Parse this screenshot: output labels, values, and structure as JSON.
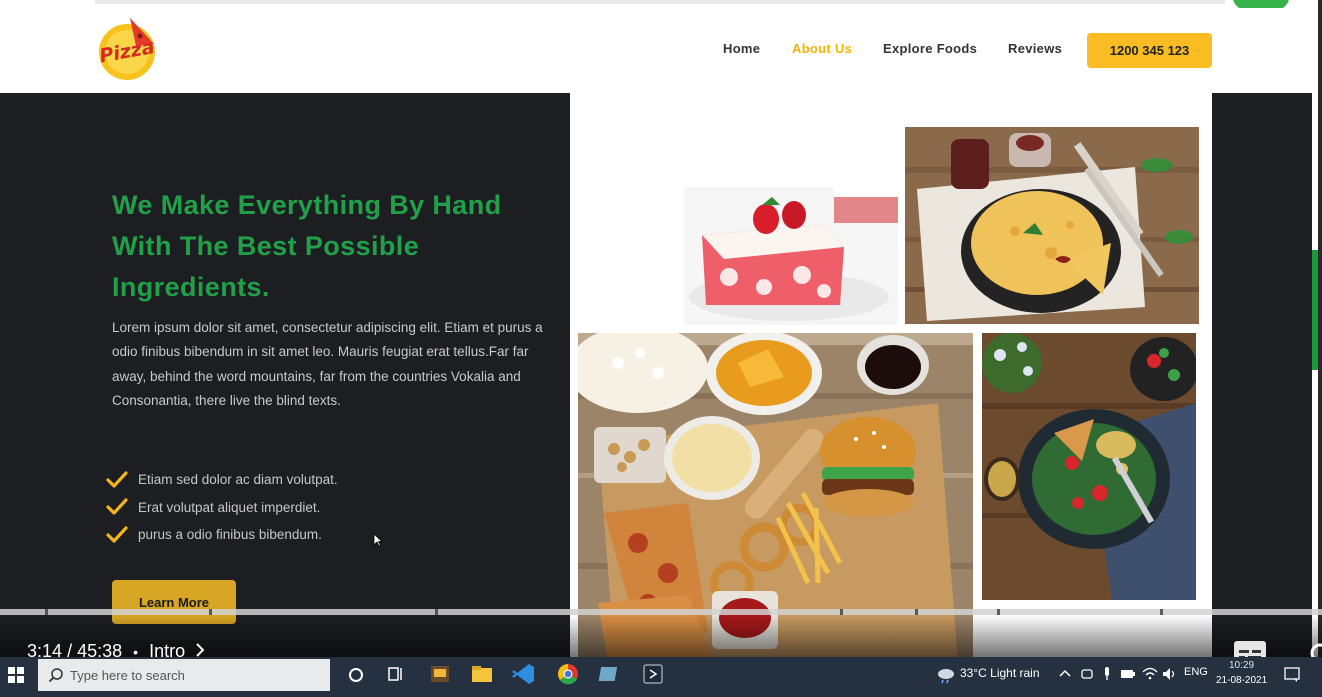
{
  "site": {
    "logo_text": "Pizza",
    "nav": {
      "items": [
        {
          "label": "Home",
          "active": false
        },
        {
          "label": "About Us",
          "active": true
        },
        {
          "label": "Explore Foods",
          "active": false
        },
        {
          "label": "Reviews",
          "active": false
        }
      ],
      "phone_button": "1200 345 123"
    },
    "about": {
      "headline_lines": [
        "We Make Everything By Hand",
        "With The Best Possible",
        "Ingredients."
      ],
      "paragraph": "Lorem ipsum dolor sit amet, consectetur adipiscing elit. Etiam et purus a odio finibus bibendum in sit amet leo. Mauris feugiat erat tellus.Far far away, behind the word mountains, far from the countries Vokalia and Consonantia, there live the blind texts.",
      "checklist": [
        "Etiam sed dolor ac diam volutpat.",
        "Erat volutpat aliquet imperdiet.",
        "purus a odio finibus bibendum."
      ],
      "button": "Learn More"
    },
    "photos": [
      "strawberry-cake-photo",
      "omelette-pan-photo",
      "fast-food-platter-photo",
      "salad-bowl-photo"
    ],
    "colors": {
      "accent_yellow": "#f9bd23",
      "headline_green": "#21a04a",
      "dark_bg": "#1d1e22"
    }
  },
  "player": {
    "current_time": "3:14",
    "separator": "/",
    "duration": "45:38",
    "chapter_bullet": "•",
    "chapter": "Intro",
    "progress_fraction": 0.07
  },
  "taskbar": {
    "search_placeholder": "Type here to search",
    "weather": "33°C  Light rain",
    "language": "ENG",
    "date": "21-08-2021",
    "time": "10:29"
  }
}
